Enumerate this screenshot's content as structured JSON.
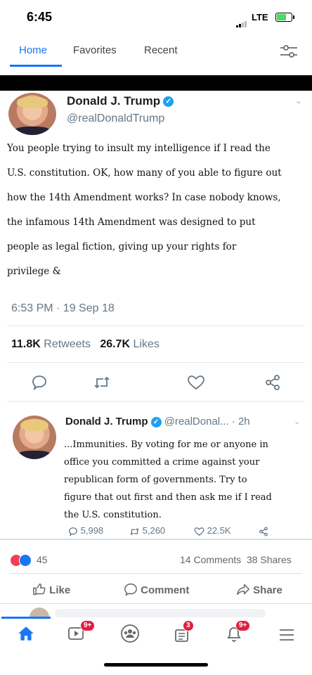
{
  "status_bar": {
    "time": "6:45",
    "network": "LTE"
  },
  "tabs": [
    {
      "label": "Home",
      "active": true
    },
    {
      "label": "Favorites",
      "active": false
    },
    {
      "label": "Recent",
      "active": false
    }
  ],
  "tweet1": {
    "name": "Donald J. Trump",
    "handle": "@realDonaldTrump",
    "lines": [
      "You people trying to insult my intelligence if I read the",
      "U.S. constitution. OK, how many of you able to figure out",
      "how the 14th Amendment works? In case nobody knows,",
      "the infamous 14th Amendment was designed to put",
      "people as legal fiction, giving up your rights for",
      "privilege &"
    ],
    "timestamp": "6:53 PM · 19 Sep 18",
    "retweets_count": "11.8K",
    "retweets_label": "Retweets",
    "likes_count": "26.7K",
    "likes_label": "Likes"
  },
  "tweet2": {
    "name": "Donald J. Trump",
    "handle_time": "@realDonal... · 2h",
    "lines": [
      "...Immunities. By voting for me or anyone in",
      "office you committed a crime against your",
      "republican form of governments. Try to",
      "figure that out first and then ask me if I read",
      "the U.S. constitution."
    ],
    "replies": "5,998",
    "retweets": "5,260",
    "likes": "22.5K"
  },
  "fb": {
    "reactions_count": "45",
    "comments": "14 Comments",
    "shares": "38 Shares",
    "like_label": "Like",
    "comment_label": "Comment",
    "share_label": "Share"
  },
  "bottom_nav": {
    "video_badge": "9+",
    "menu_badge_1": "3",
    "notif_badge": "9+"
  },
  "colors": {
    "accent": "#1877f2",
    "twitter_blue": "#1da1f2",
    "badge_red": "#e41e3f"
  }
}
